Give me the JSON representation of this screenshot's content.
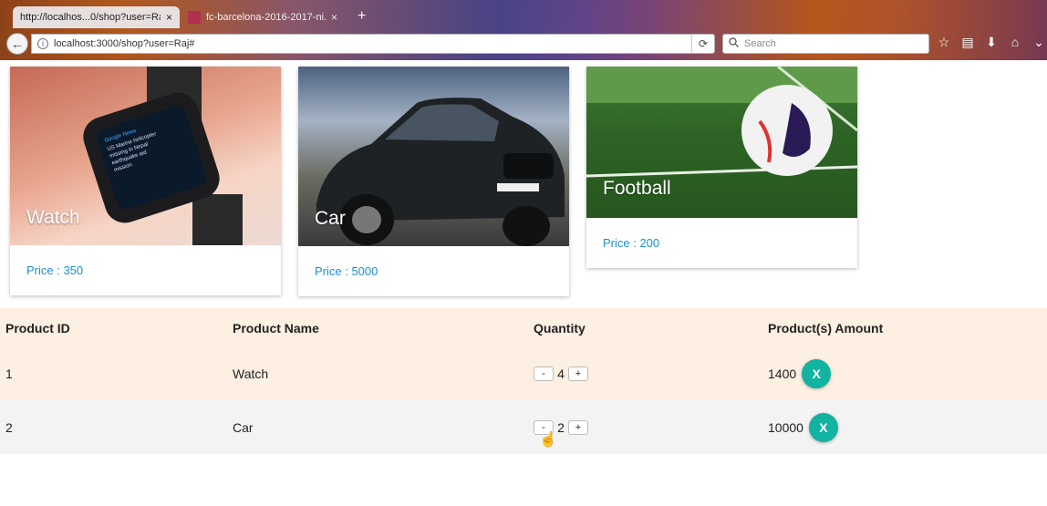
{
  "browser": {
    "tabs": [
      {
        "title": "http://localhos...0/shop?user=Raj",
        "close": "×"
      },
      {
        "title": "fc-barcelona-2016-2017-ni...",
        "close": "×"
      }
    ],
    "new_tab": "+",
    "back": "←",
    "url": "localhost:3000/shop?user=Raj#",
    "reload": "⟳",
    "search_placeholder": "Search",
    "tools": [
      "☆",
      "▤",
      "⬇",
      "⌂",
      "⌄"
    ]
  },
  "products": [
    {
      "name": "Watch",
      "price": "Price : 350"
    },
    {
      "name": "Car",
      "price": "Price : 5000"
    },
    {
      "name": "Football",
      "price": "Price : 200"
    }
  ],
  "cart": {
    "headers": [
      "Product ID",
      "Product Name",
      "Quantity",
      "Product(s) Amount"
    ],
    "rows": [
      {
        "id": "1",
        "name": "Watch",
        "qty": "4",
        "amount": "1400"
      },
      {
        "id": "2",
        "name": "Car",
        "qty": "2",
        "amount": "10000"
      }
    ],
    "minus_label": "-",
    "plus_label": "+",
    "remove_label": "X"
  },
  "colors": {
    "price_text": "#1a8fd8",
    "cart_header_bg": "#fdefe1",
    "remove_button": "#12b3a0"
  }
}
